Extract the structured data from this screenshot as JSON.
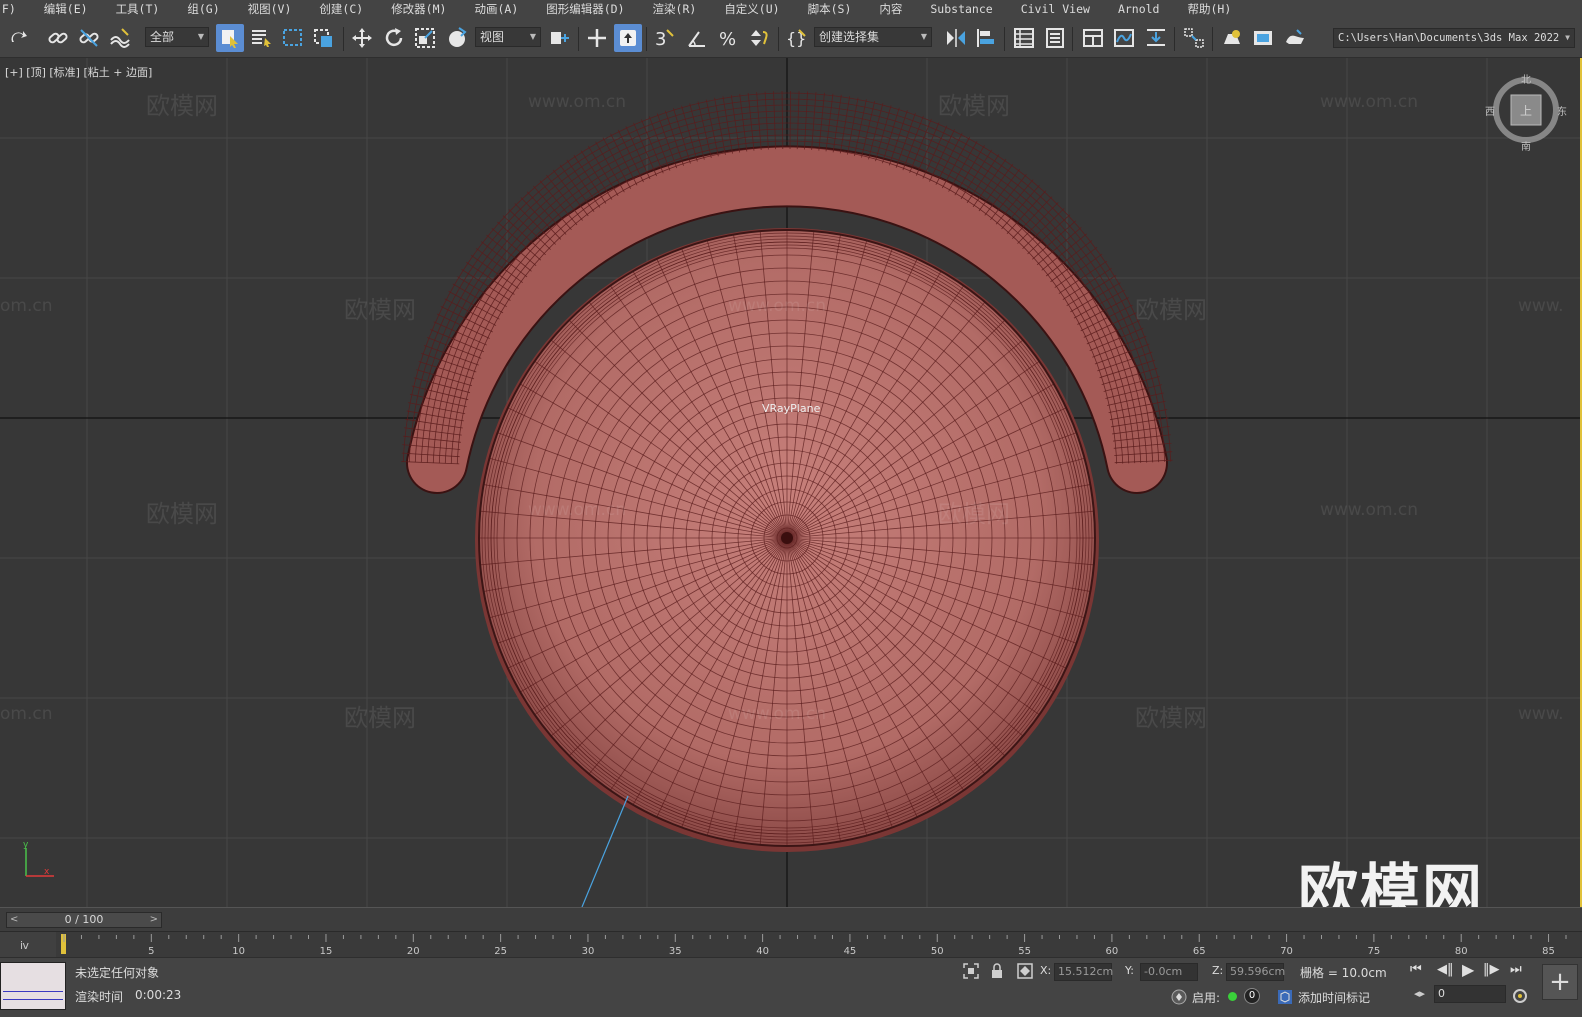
{
  "menu": [
    "文件(F)",
    "编辑(E)",
    "工具(T)",
    "组(G)",
    "视图(V)",
    "创建(C)",
    "修改器(M)",
    "动画(A)",
    "图形编辑器(D)",
    "渲染(R)",
    "自定义(U)",
    "脚本(S)",
    "内容",
    "Substance",
    "Civil View",
    "Arnold",
    "帮助(H)"
  ],
  "toolbar": {
    "selection_filter": "全部",
    "ref_coord": "视图",
    "named_selection": "创建选择集",
    "path": "C:\\Users\\Han\\Documents\\3ds Max 2022"
  },
  "viewport": {
    "label": "[+] [顶] [标准] [粘土 + 边面]",
    "object_label": "VRayPlane",
    "watermark_text": "欧模网",
    "watermark_url": "www.om.cn",
    "watermark_url_partial": "om.cn",
    "watermark_url_right": "www.",
    "big_watermark": "欧模网",
    "viewcube": {
      "north": "北",
      "south": "南",
      "east": "东",
      "west": "西",
      "face": "上"
    },
    "axis": {
      "y": "y",
      "x": "x"
    }
  },
  "timeline": {
    "frame_display": "0 / 100",
    "ticks": [
      "5",
      "10",
      "15",
      "20",
      "25",
      "30",
      "35",
      "40",
      "45",
      "50",
      "55",
      "60",
      "65",
      "70",
      "75",
      "80",
      "85"
    ]
  },
  "status": {
    "selection": "未选定任何对象",
    "render_time_label": "渲染时间",
    "render_time": "0:00:23",
    "x_label": "X:",
    "x_value": "15.512cm",
    "y_label": "Y:",
    "y_value": "-0.0cm",
    "z_label": "Z:",
    "z_value": "59.596cm",
    "grid": "栅格 = 10.0cm",
    "enable_label": "启用:",
    "enable_count": "0",
    "add_time_tag": "添加时间标记",
    "current_frame": "0"
  },
  "colors": {
    "model": "#b86a66",
    "wire": "#5a1c1c",
    "bg": "#373737",
    "accent": "#5b8dd3"
  }
}
